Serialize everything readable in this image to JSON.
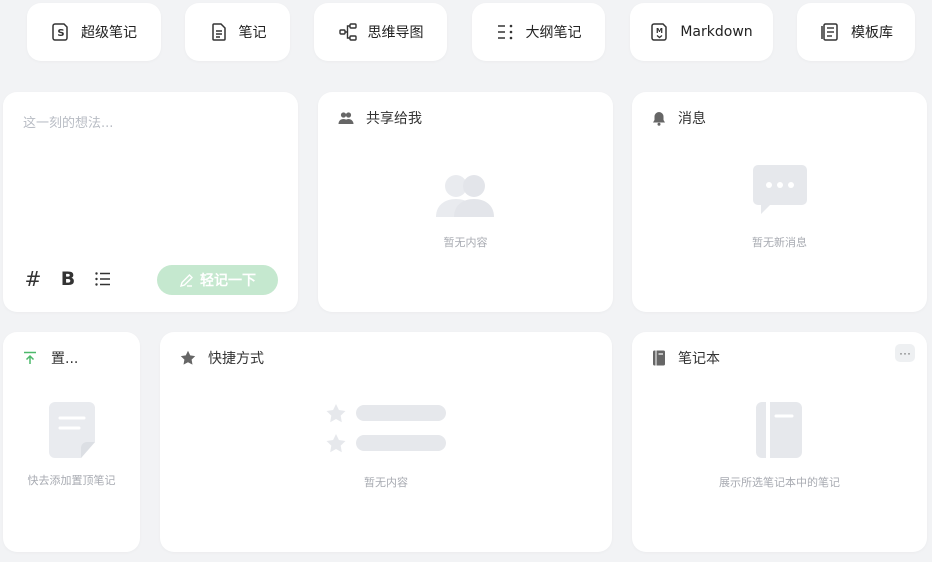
{
  "toolbar": [
    {
      "label": "超级笔记",
      "icon": "super-note-icon"
    },
    {
      "label": "笔记",
      "icon": "note-icon"
    },
    {
      "label": "思维导图",
      "icon": "mindmap-icon"
    },
    {
      "label": "大纲笔记",
      "icon": "outline-icon"
    },
    {
      "label": "Markdown",
      "icon": "markdown-icon"
    },
    {
      "label": "模板库",
      "icon": "template-icon"
    }
  ],
  "memo": {
    "placeholder": "这一刻的想法...",
    "tag_symbol": "#",
    "bold_symbol": "B",
    "submit_label": "轻记一下"
  },
  "shared": {
    "title": "共享给我",
    "empty": "暂无内容"
  },
  "messages": {
    "title": "消息",
    "empty": "暂无新消息"
  },
  "pinned": {
    "title": "置...",
    "empty": "快去添加置顶笔记"
  },
  "shortcuts": {
    "title": "快捷方式",
    "empty": "暂无内容"
  },
  "notebook": {
    "title": "笔记本",
    "empty": "展示所选笔记本中的笔记",
    "more": "···"
  },
  "colors": {
    "accent": "#4cb86a",
    "accent_light": "#c5e8cf",
    "placeholder_gray": "#e6e8ec",
    "bg": "#f2f3f5"
  }
}
